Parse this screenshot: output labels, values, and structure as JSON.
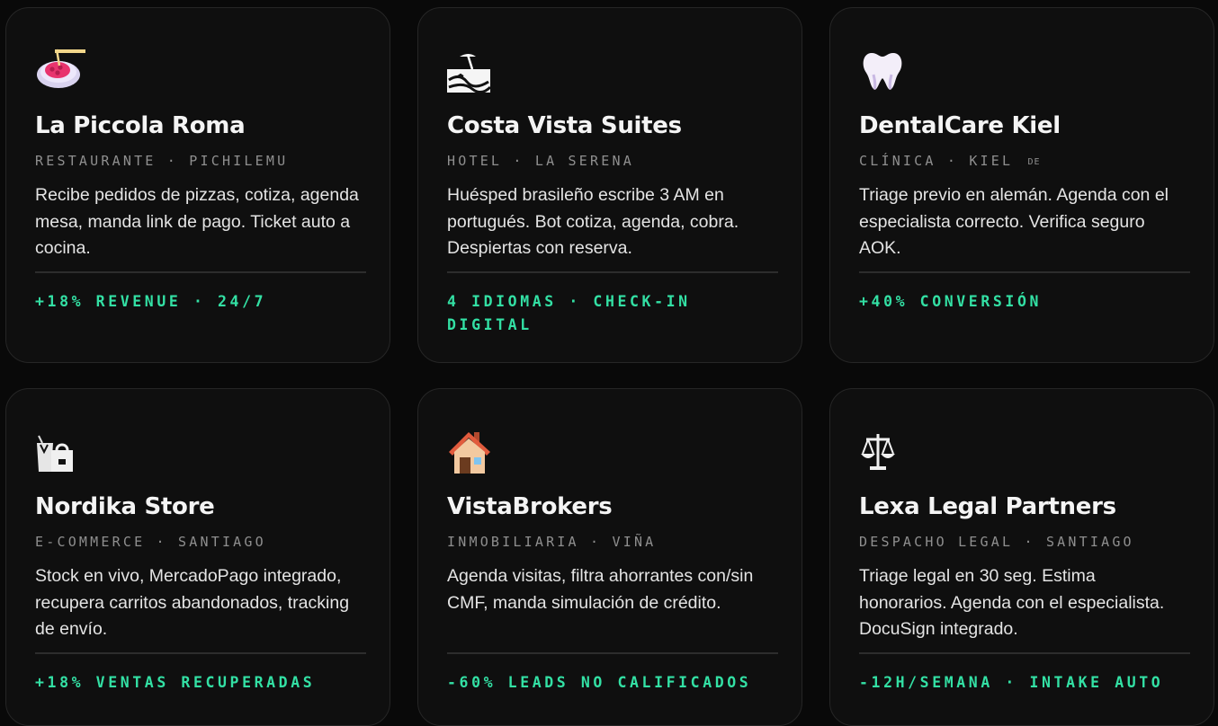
{
  "cards": [
    {
      "icon": "spaghetti-icon",
      "name": "La Piccola Roma",
      "category": "RESTAURANTE",
      "location": "PICHILEMU",
      "location_tag": "",
      "description": "Recibe pedidos de pizzas, cotiza, agenda mesa, manda link de pago. Ticket auto a cocina.",
      "metric": "+18% REVENUE · 24/7"
    },
    {
      "icon": "beach-umbrella-icon",
      "name": "Costa Vista Suites",
      "category": "HOTEL",
      "location": "LA SERENA",
      "location_tag": "",
      "description": "Huésped brasileño escribe 3 AM en portugués. Bot cotiza, agenda, cobra. Despiertas con reserva.",
      "metric": "4 IDIOMAS · CHECK-IN DIGITAL"
    },
    {
      "icon": "tooth-icon",
      "name": "DentalCare Kiel",
      "category": "CLÍNICA",
      "location": "KIEL",
      "location_tag": "DE",
      "description": "Triage previo en alemán. Agenda con el especialista correcto. Verifica seguro AOK.",
      "metric": "+40% CONVERSIÓN"
    },
    {
      "icon": "shopping-bags-icon",
      "name": "Nordika Store",
      "category": "E-COMMERCE",
      "location": "SANTIAGO",
      "location_tag": "",
      "description": "Stock en vivo, MercadoPago integrado, recupera carritos abandonados, tracking de envío.",
      "metric": "+18% VENTAS RECUPERADAS"
    },
    {
      "icon": "house-icon",
      "name": "VistaBrokers",
      "category": "INMOBILIARIA",
      "location": "VIÑA",
      "location_tag": "",
      "description": "Agenda visitas, filtra ahorrantes con/sin CMF, manda simulación de crédito.",
      "metric": "-60% LEADS NO CALIFICADOS"
    },
    {
      "icon": "balance-scale-icon",
      "name": "Lexa Legal Partners",
      "category": "DESPACHO LEGAL",
      "location": "SANTIAGO",
      "location_tag": "",
      "description": "Triage legal en 30 seg. Estima honorarios. Agenda con el especialista. DocuSign integrado.",
      "metric": "-12H/SEMANA · INTAKE AUTO"
    }
  ],
  "separator": "·",
  "colors": {
    "background": "#090909",
    "card": "#0f0f0f",
    "border": "#262626",
    "accent": "#33e0a4",
    "meta": "#8f8f8f"
  }
}
